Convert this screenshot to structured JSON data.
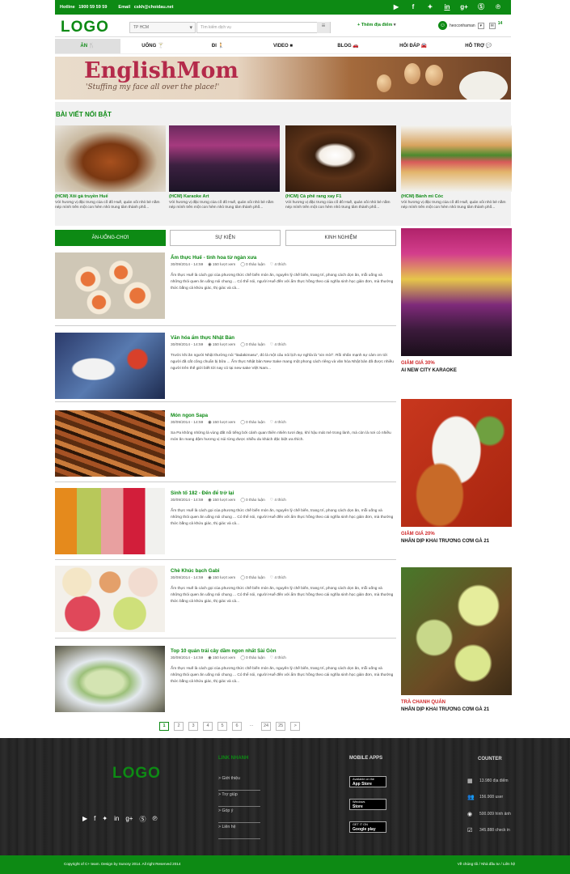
{
  "topbar": {
    "hotline_label": "Hotline",
    "hotline": "1900 59 59 59",
    "email_label": "Email",
    "email": "cskh@choidau.net"
  },
  "header": {
    "logo": "LOGO",
    "city": "TP HCM",
    "search_placeholder": "Tìm kiếm dịch vụ",
    "add_place": "+ Thêm địa điểm",
    "username": "heoconhaman",
    "notif_count": "14"
  },
  "nav": [
    "ĂN",
    "UỐNG",
    "ĐI",
    "VIDEO",
    "BLOG",
    "HỎI ĐÁP",
    "HỖ TRỢ"
  ],
  "banner": {
    "title": "EnglishMom",
    "subtitle": "'Stuffing my face all over the place!'"
  },
  "featured": {
    "heading": "BÀI VIẾT NỔI BẬT",
    "items": [
      {
        "title": "(HCM) Xôi gà truyền Huế",
        "desc": "Với hương vị đặc trưng của cố đô Huế, quán xôi nhỏ bé nằm nép mình trên một con hẻm nhỏ trung tâm thành phố..."
      },
      {
        "title": "(HCM) Karaoke Art",
        "desc": "Với hương vị đặc trưng của cố đô Huế, quán xôi nhỏ bé nằm nép mình trên một con hẻm nhỏ trung tâm thành phố..."
      },
      {
        "title": "(HCM) Cà phê rang xay F1",
        "desc": "Với hương vị đặc trưng của cố đô Huế, quán xôi nhỏ bé nằm nép mình trên một con hẻm nhỏ trung tâm thành phố..."
      },
      {
        "title": "(HCM) Bánh mì Cóc",
        "desc": "Với hương vị đặc trưng của cố đô Huế, quán xôi nhỏ bé nằm nép mình trên một con hẻm nhỏ trung tâm thành phố..."
      }
    ]
  },
  "tabs": [
    "ĂN-UỐNG-CHƠI",
    "SỰ KIỆN",
    "KINH NGHIỆM"
  ],
  "articles": [
    {
      "title": "Ẩm thực Huế - tinh hoa từ ngàn xưa",
      "date": "30/09/2014 - 14:59",
      "views": "150 lượt xem",
      "comments": "0 thảo luận",
      "likes": "4 thích",
      "desc": "Ẩm thực Huế là cách gọi của phương thức chế biến món ăn, nguyên lý chế biến, trang trí, phong cách dọn ăn, mỗi uống và những thói quen ăn uống nói chung ... Có thể nói, người Huế đến với ẩm thực hồng theo cái nghĩa sinh học giản đơn, mà thưởng thức bằng cả khứu giác, thị giác và cả..."
    },
    {
      "title": "Văn hóa ẩm thực Nhật Bản",
      "date": "30/09/2014 - 14:59",
      "views": "150 lượt xem",
      "comments": "0 thảo luận",
      "likes": "4 thích",
      "desc": "Trước khi ăn người Nhật thường nói \"itadakimasu\", đó là một câu nói lịch sự nghĩa là \"xin mời\". Rồi nhấn mạnh sự cảm ơn tới người đã cất công chuẩn bị bữa ... Ẩm thực Nhật bản New Sake mang một phong cách riêng và văn hóa Nhật bản đã được nhiều người trên thế giới biết tới nay có tại new sake Việt Nam..."
    },
    {
      "title": "Món ngon Sapa",
      "date": "30/09/2014 - 14:59",
      "views": "150 lượt xem",
      "comments": "0 thảo luận",
      "likes": "4 thích",
      "desc": "Sa Pa không những là vùng đất nổi tiếng bởi cảnh quan thiên nhiên tươi đẹp, khí hậu mát mẻ trong lành, mà còn là nơi có nhiều món ăn mang đậm hương vị núi rừng được nhiều du khách đặc biệt ưa thích."
    },
    {
      "title": "Sinh tố 182 - Đến để trở lại",
      "date": "30/09/2014 - 14:59",
      "views": "150 lượt xem",
      "comments": "0 thảo luận",
      "likes": "4 thích",
      "desc": "Ẩm thực Huế là cách gọi của phương thức chế biến món ăn, nguyên lý chế biến, trang trí, phong cách dọn ăn, mỗi uống và những thói quen ăn uống nói chung ... Có thể nói, người Huế đến với ẩm thực hồng theo cái nghĩa sinh học giản đơn, mà thưởng thức bằng cả khứu giác, thị giác và cả..."
    },
    {
      "title": "Chè Khúc bạch Gabi",
      "date": "30/09/2014 - 14:59",
      "views": "150 lượt xem",
      "comments": "0 thảo luận",
      "likes": "4 thích",
      "desc": "Ẩm thực Huế là cách gọi của phương thức chế biến món ăn, nguyên lý chế biến, trang trí, phong cách dọn ăn, mỗi uống và những thói quen ăn uống nói chung ... Có thể nói, người Huế đến với ẩm thực hồng theo cái nghĩa sinh học giản đơn, mà thưởng thức bằng cả khứu giác, thị giác và cả..."
    },
    {
      "title": "Top 10 quán trái cây dầm ngon nhất Sài Gòn",
      "date": "30/09/2014 - 14:59",
      "views": "150 lượt xem",
      "comments": "0 thảo luận",
      "likes": "4 thích",
      "desc": "Ẩm thực Huế là cách gọi của phương thức chế biến món ăn, nguyên lý chế biến, trang trí, phong cách dọn ăn, mỗi uống và những thói quen ăn uống nói chung ... Có thể nói, người Huế đến với ẩm thực hồng theo cái nghĩa sinh học giản đơn, mà thưởng thức bằng cả khứu giác, thị giác và cả..."
    }
  ],
  "sidebar": [
    {
      "promo": "GIẢM GIÁ 30%",
      "name": "AI NEW CITY KARAOKE"
    },
    {
      "promo": "GIẢM GIÁ 20%",
      "name": "NHÂN DỊP KHAI TRƯƠNG CƠM GÀ 21"
    },
    {
      "promo": "TRÀ CHANH QUÁN",
      "name": "NHÂN DỊP KHAI TRƯƠNG CƠM GÀ 21"
    }
  ],
  "pagination": [
    "1",
    "2",
    "3",
    "4",
    "5",
    "6",
    "...",
    "24",
    "25",
    ">"
  ],
  "footer": {
    "logo": "LOGO",
    "links_heading": "LINK NHANH",
    "links": [
      "> Giới thiệu",
      "> Trợ giúp",
      "> Góp ý",
      "> Liên hệ"
    ],
    "apps_heading": "MOBILE APPS",
    "apps": [
      {
        "top": "Available on the",
        "bottom": "App Store"
      },
      {
        "top": "Windows",
        "bottom": "Store"
      },
      {
        "top": "GET IT ON",
        "bottom": "Google play"
      }
    ],
    "counter_heading": "COUNTER",
    "counters": [
      "13.980 địa điểm",
      "156.908 user",
      "500.009 hình ảnh",
      "345.888 check in"
    ]
  },
  "bottombar": {
    "copyright": "Copyright of C+ team. Design by Suncsy 2014. All right Reserved 2014",
    "right": "Về chúng tôi / Nhà đầu tư / Liên hệ"
  },
  "colors": {
    "brand": "#0d8a14",
    "promo": "#d0282a",
    "footer_bg": "#262626"
  }
}
